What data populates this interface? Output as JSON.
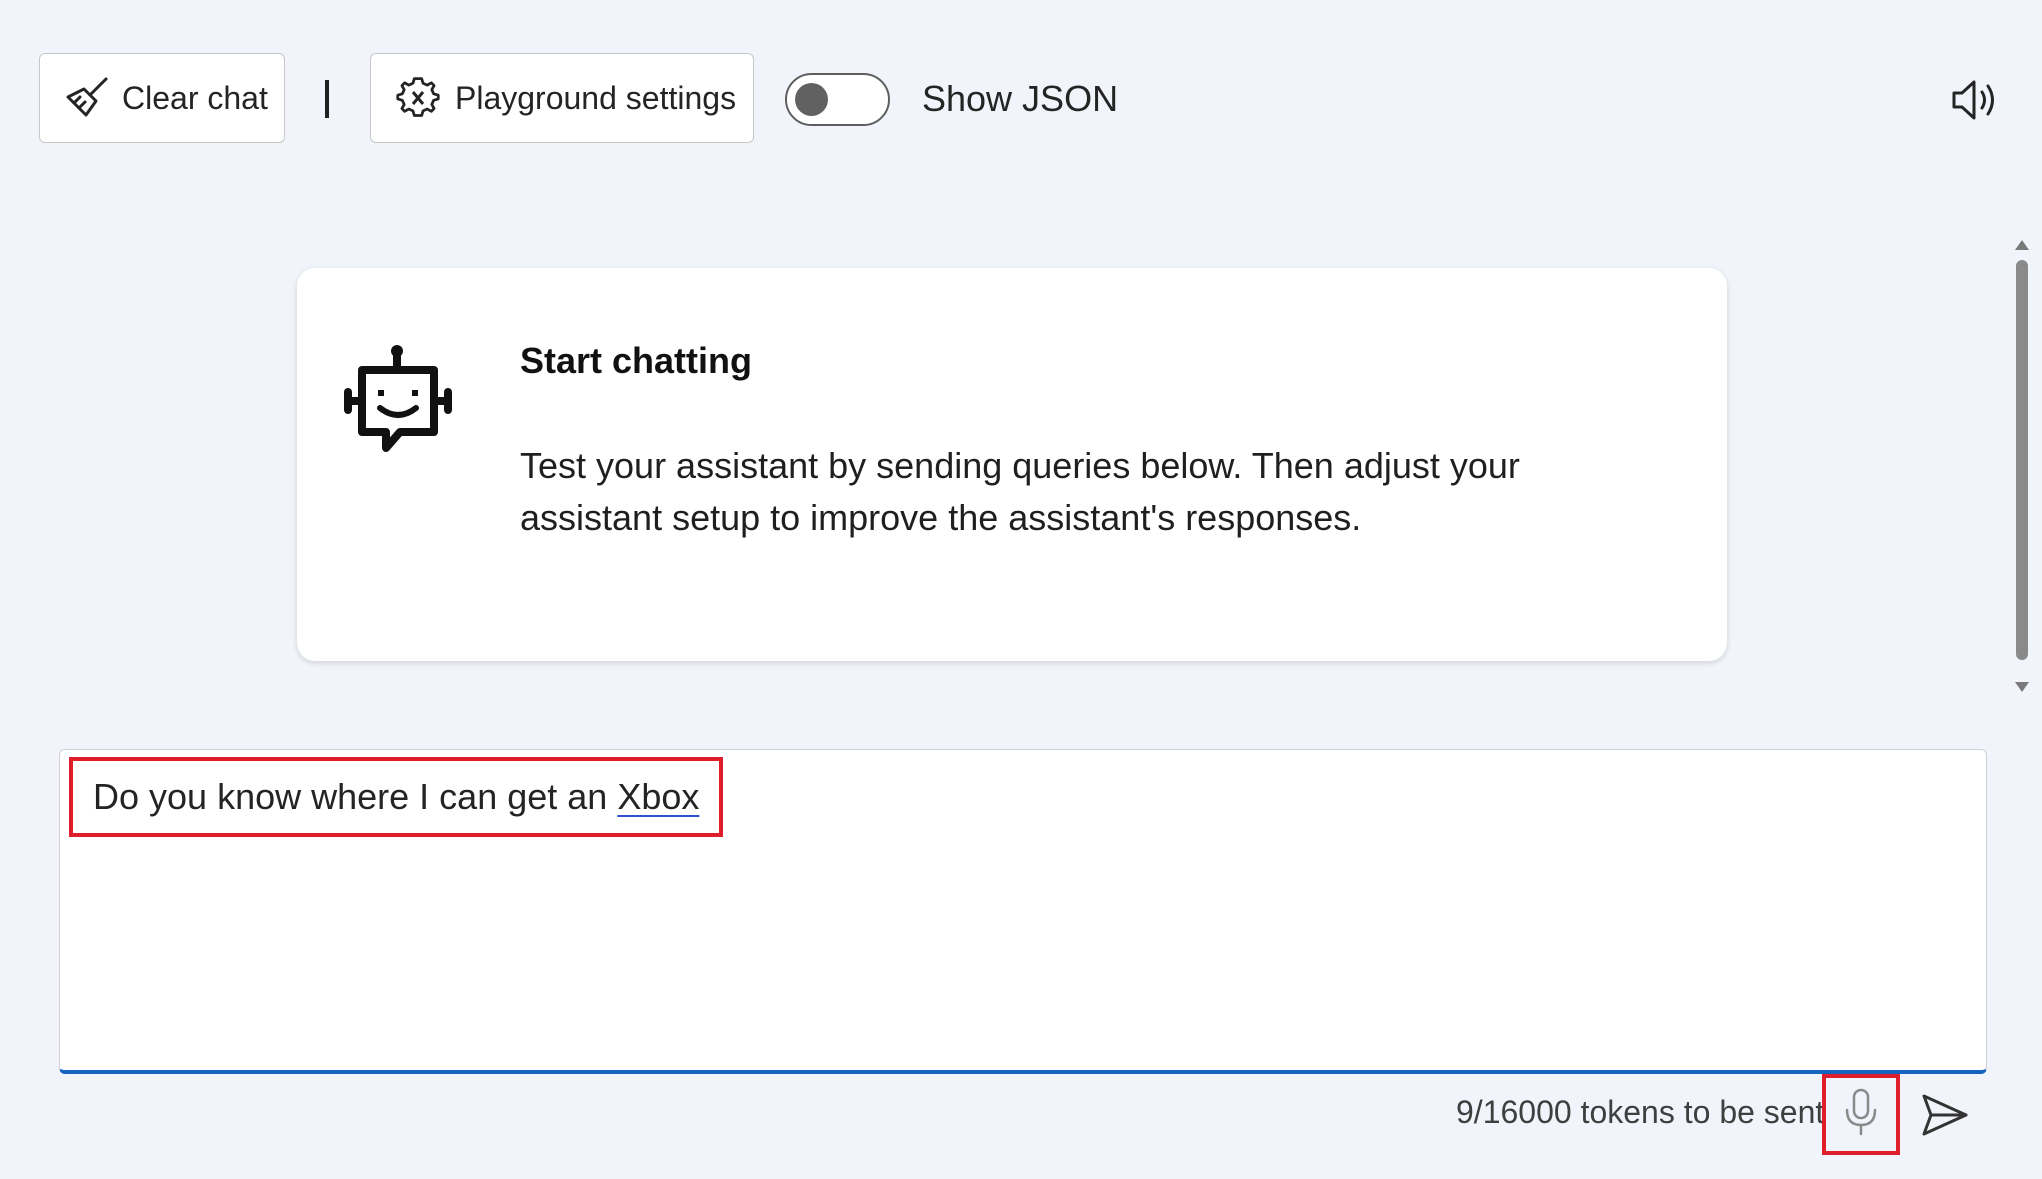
{
  "toolbar": {
    "clear_chat_label": "Clear chat",
    "settings_label": "Playground settings",
    "show_json_label": "Show JSON",
    "show_json_on": false
  },
  "card": {
    "title": "Start chatting",
    "body": "Test your assistant by sending queries below. Then adjust your assistant setup to improve the assistant's responses."
  },
  "input": {
    "text_prefix": "Do you know where I can get an ",
    "text_underlined": "Xbox"
  },
  "footer": {
    "token_count": "9/16000 tokens to be sent"
  },
  "icons": {
    "clear": "broom-icon",
    "settings": "gear-icon",
    "speaker": "speaker-icon",
    "bot": "bot-icon",
    "mic": "microphone-icon",
    "send": "send-icon"
  },
  "colors": {
    "accent": "#1565c0",
    "highlight": "#e01e2b",
    "background": "#f1f5fb"
  }
}
